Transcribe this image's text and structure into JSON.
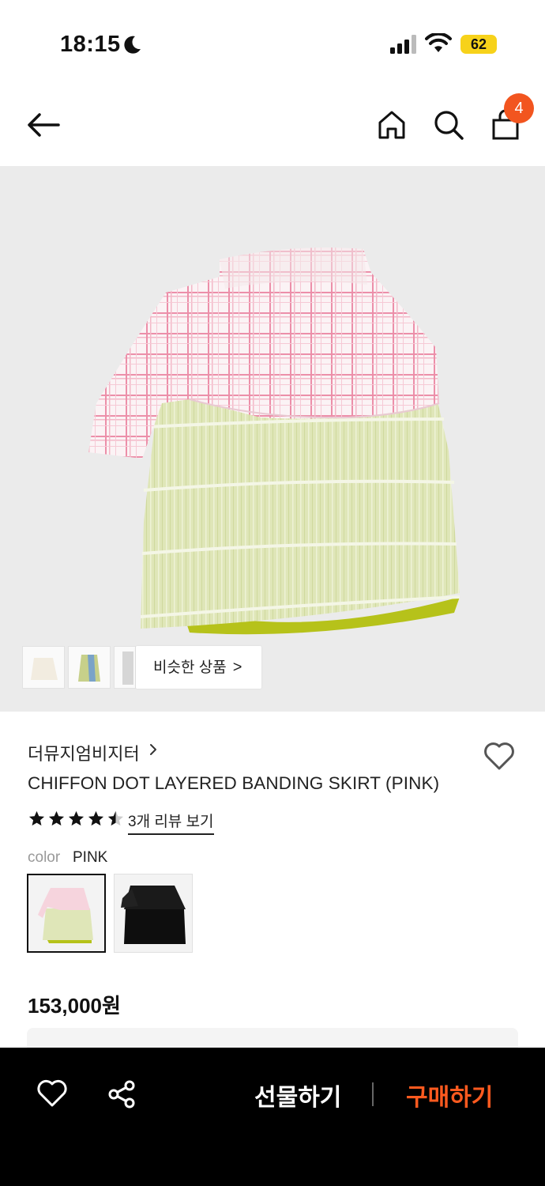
{
  "status_bar": {
    "time": "18:15",
    "battery": "62"
  },
  "nav": {
    "cart_count": "4",
    "icons": [
      "back-arrow-icon",
      "home-icon",
      "search-icon",
      "shopping-bag-icon"
    ]
  },
  "gallery": {
    "similar_products_label": "비슷한 상품",
    "similar_chevron": ">"
  },
  "product": {
    "brand": "더뮤지엄비지터",
    "title": "CHIFFON DOT LAYERED BANDING SKIRT (PINK)",
    "rating": 4.5,
    "review_link": "3개 리뷰 보기",
    "color_label": "color",
    "color_value": "PINK",
    "color_options": [
      "PINK",
      "BLACK"
    ],
    "price": "153,000원"
  },
  "bottom_bar": {
    "gift_label": "선물하기",
    "buy_label": "구매하기",
    "accent_color": "#ff5a1f"
  },
  "colors": {
    "badge": "#f2551f",
    "hero_bg": "#ebebeb"
  }
}
